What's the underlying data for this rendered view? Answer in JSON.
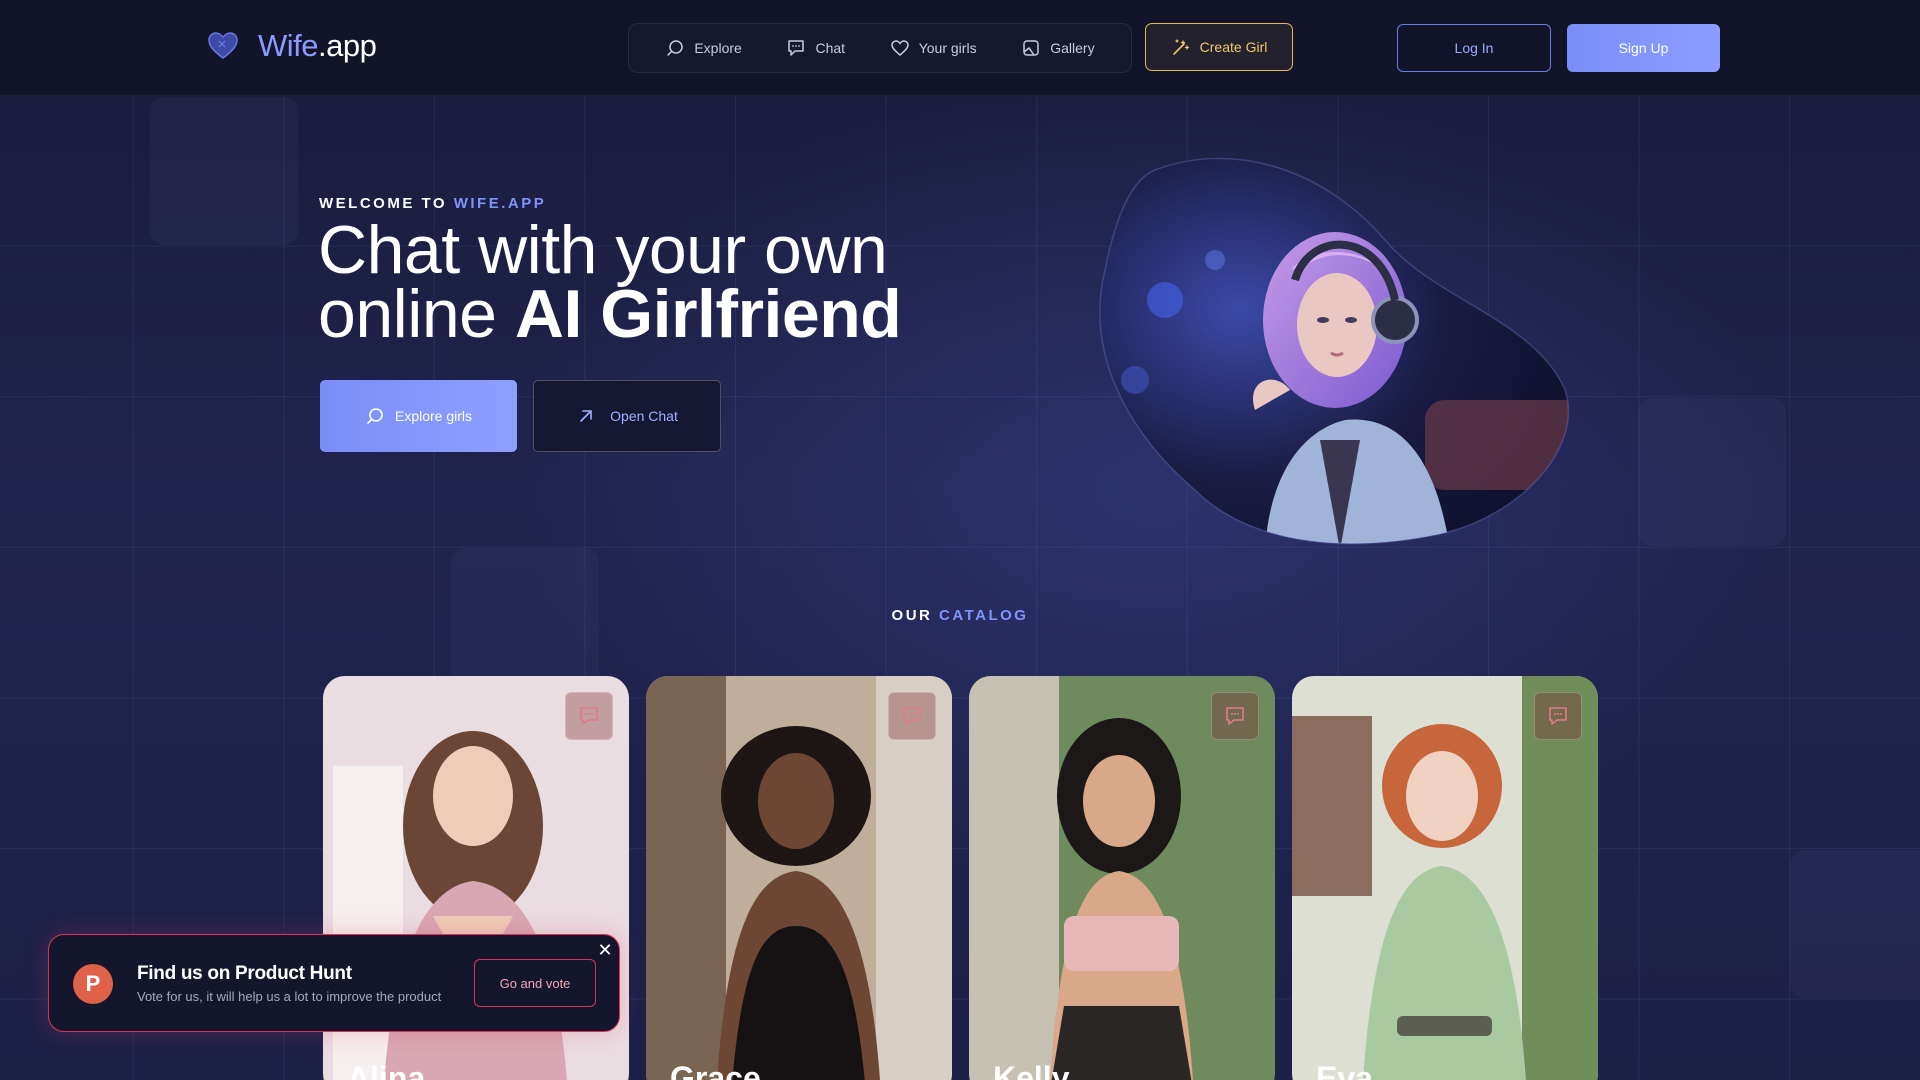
{
  "header": {
    "logo_first": "Wife",
    "logo_second": ".app",
    "nav": [
      {
        "label": "Explore",
        "icon": "search-icon"
      },
      {
        "label": "Chat",
        "icon": "chat-icon"
      },
      {
        "label": "Your girls",
        "icon": "heart-icon"
      },
      {
        "label": "Gallery",
        "icon": "gallery-icon"
      }
    ],
    "create_label": "Create Girl",
    "login_label": "Log In",
    "signup_label": "Sign Up"
  },
  "hero": {
    "eyebrow_prefix": "WELCOME TO ",
    "eyebrow_highlight": "WIFE.APP",
    "title_line1": "Chat with your own",
    "title_line2_normal": "online ",
    "title_line2_bold": "AI Girlfriend",
    "explore_label": "Explore girls",
    "openchat_label": "Open Chat"
  },
  "catalog": {
    "label_prefix": "OUR ",
    "label_highlight": "CATALOG",
    "cards": [
      {
        "name": "Alina",
        "palette": [
          "#efe3e6",
          "#c89aa5",
          "#7a4a3a"
        ]
      },
      {
        "name": "Grace",
        "palette": [
          "#c9b8a5",
          "#5a4538",
          "#1a1416"
        ]
      },
      {
        "name": "Kelly",
        "palette": [
          "#7c8d66",
          "#e2b7b4",
          "#2a2a2a"
        ]
      },
      {
        "name": "Eva",
        "palette": [
          "#d9dccc",
          "#9fc09a",
          "#c5643a"
        ]
      }
    ]
  },
  "toast": {
    "logo_letter": "P",
    "title": "Find us on Product Hunt",
    "subtitle": "Vote for us, it will help us a lot to improve the product",
    "vote_label": "Go and vote",
    "close_symbol": "✕"
  }
}
